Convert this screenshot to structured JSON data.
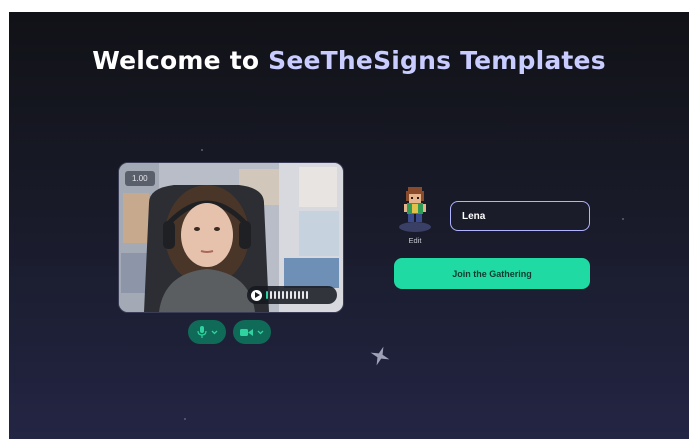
{
  "header": {
    "welcome_prefix": "Welcome to",
    "space_name": "SeeTheSigns Templates"
  },
  "video": {
    "zoom_badge": "1.00",
    "audio_level_active_bars": 1,
    "audio_level_total_bars": 11
  },
  "controls": {
    "mic_icon": "microphone-icon",
    "camera_icon": "camera-icon",
    "chevron_icon": "chevron-down-icon"
  },
  "profile": {
    "edit_label": "Edit",
    "name_value": "Lena"
  },
  "join_button_label": "Join the Gathering",
  "colors": {
    "accent": "#1fdba3",
    "brand_text": "#c9ccff",
    "input_border": "#b0b4ff",
    "control_bg": "#0f6b57"
  }
}
